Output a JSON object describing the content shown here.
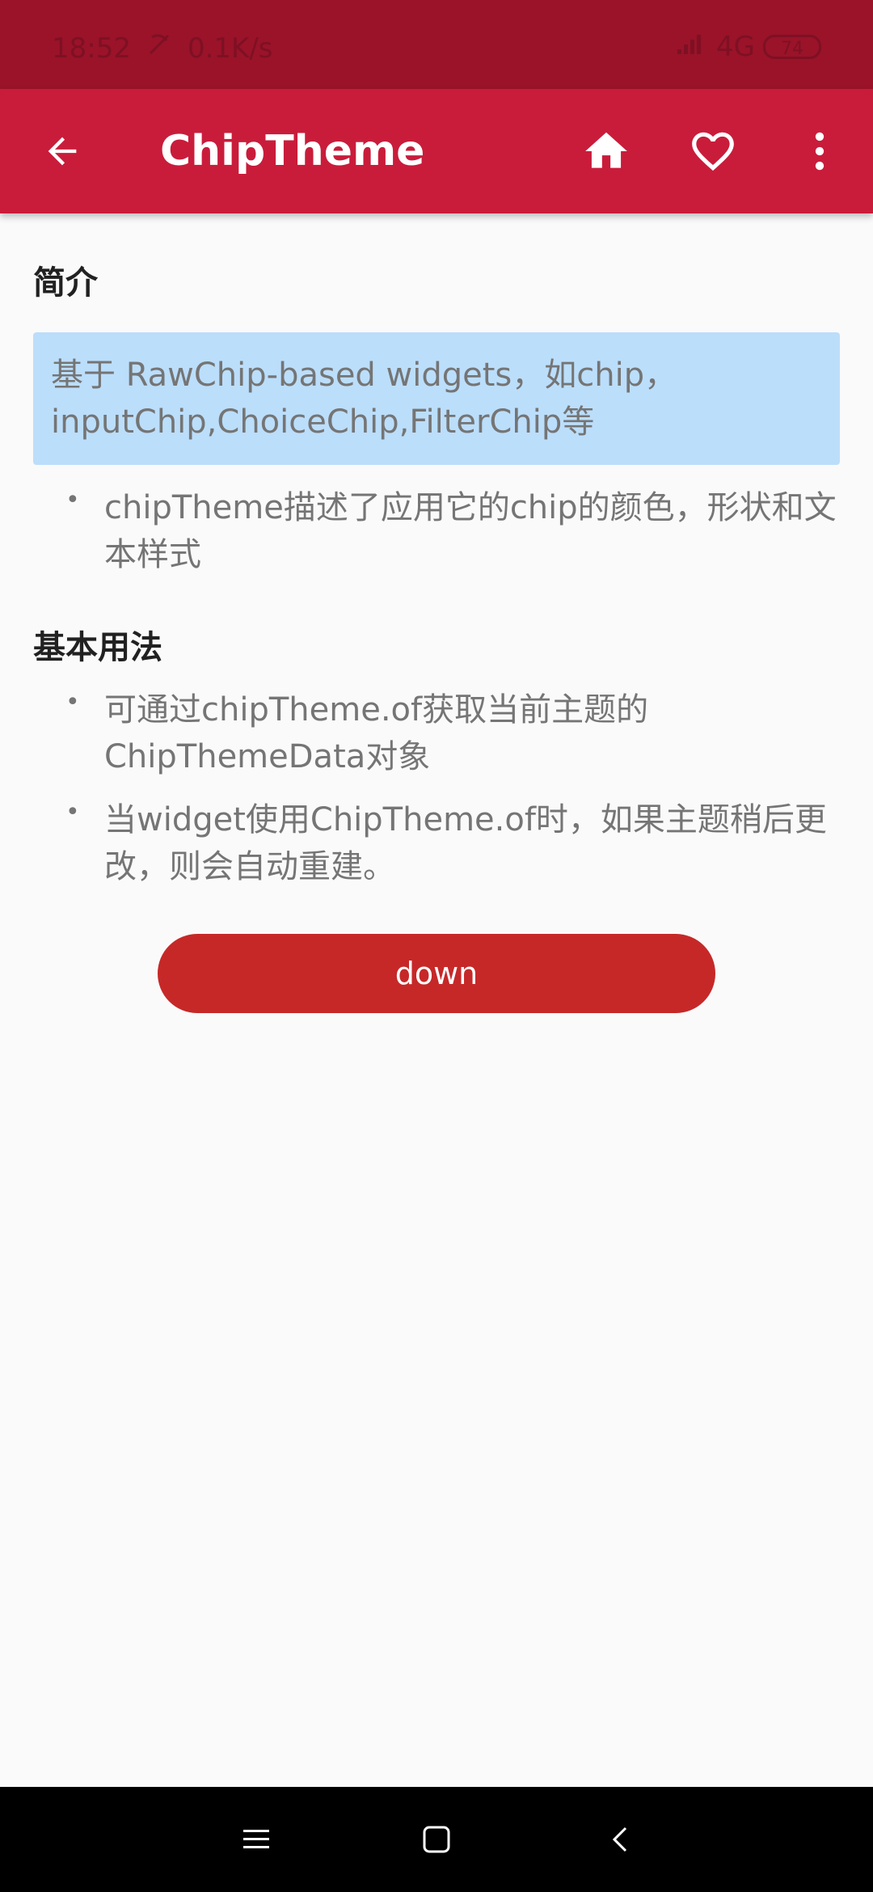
{
  "status_bar": {
    "time": "18:52",
    "network_speed": "0.1K/s",
    "network_type": "4G",
    "battery": "74"
  },
  "app_bar": {
    "title": "ChipTheme",
    "actions": [
      "home-icon",
      "heart-icon",
      "more-vertical-icon"
    ]
  },
  "intro": {
    "heading": "简介",
    "highlight": "基于 RawChip-based widgets，如chip，inputChip,ChoiceChip,FilterChip等",
    "bullets": [
      "chipTheme描述了应用它的chip的颜色，形状和文本样式"
    ]
  },
  "usage": {
    "heading": "基本用法",
    "bullets": [
      "可通过chipTheme.of获取当前主题的ChipThemeData对象",
      "当widget使用ChipTheme.of时，如果主题稍后更改，则会自动重建。"
    ]
  },
  "button": {
    "label": "down"
  },
  "nav_bar": {
    "buttons": [
      "menu-icon",
      "home-square-icon",
      "back-chevron-icon"
    ]
  },
  "colors": {
    "status_bar": "#9a1329",
    "app_bar": "#c91c3b",
    "button": "#c62828",
    "intro_box": "#bbdefb",
    "background": "#fafafa"
  }
}
